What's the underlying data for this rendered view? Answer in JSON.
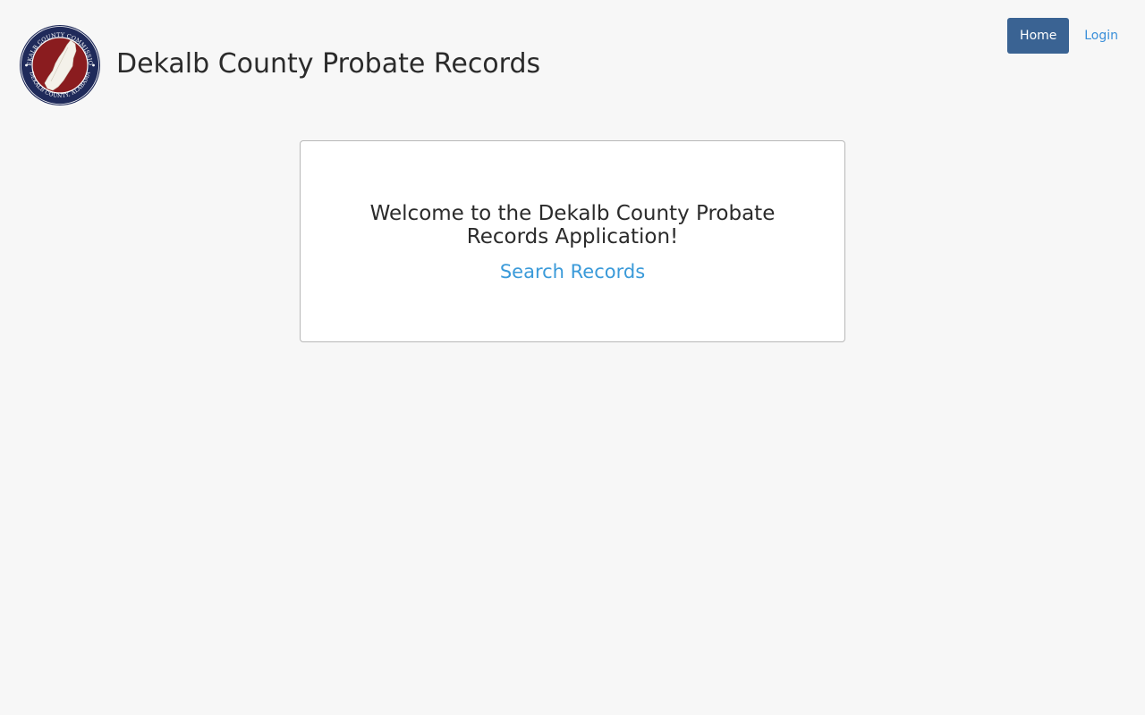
{
  "header": {
    "title": "Dekalb County Probate Records",
    "seal": {
      "icon": "county-seal-icon",
      "top_text": "DEKALB COUNTY COMMISSION",
      "bottom_text": "DEKALB COUNTY, ALABAMA",
      "colors": {
        "ring": "#1f2a5a",
        "field": "#8a1c1f",
        "map": "#f4f1ea"
      }
    }
  },
  "nav": {
    "home_label": "Home",
    "login_label": "Login"
  },
  "main": {
    "welcome_text": "Welcome to the Dekalb County Probate Records Application!",
    "search_link_label": "Search Records"
  },
  "colors": {
    "background": "#f7f7f7",
    "primary_button": "#3a6393",
    "link": "#3a9ad9",
    "text": "#2b2b2b"
  }
}
